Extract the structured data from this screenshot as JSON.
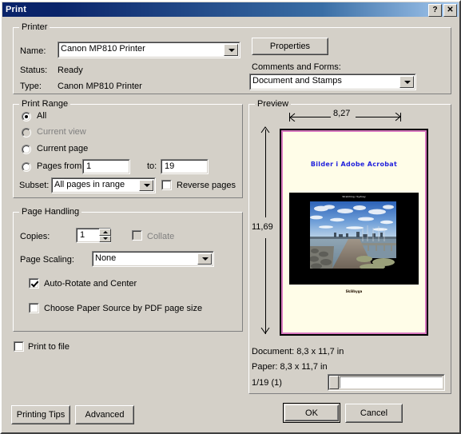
{
  "window": {
    "title": "Print",
    "help_button": "?",
    "close_button": "✕"
  },
  "printer": {
    "group_title": "Printer",
    "name_label": "Name:",
    "name_value": "Canon MP810 Printer",
    "status_label": "Status:",
    "status_value": "Ready",
    "type_label": "Type:",
    "type_value": "Canon MP810 Printer",
    "properties_button": "Properties",
    "comments_label": "Comments and Forms:",
    "comments_value": "Document and Stamps"
  },
  "print_range": {
    "group_title": "Print Range",
    "all_label": "All",
    "current_view_label": "Current view",
    "current_page_label": "Current page",
    "pages_from_label": "Pages from:",
    "pages_from_value": "1",
    "to_label": "to:",
    "to_value": "19",
    "subset_label": "Subset:",
    "subset_value": "All pages in range",
    "reverse_label": "Reverse pages"
  },
  "page_handling": {
    "group_title": "Page Handling",
    "copies_label": "Copies:",
    "copies_value": "1",
    "collate_label": "Collate",
    "scaling_label": "Page Scaling:",
    "scaling_value": "None",
    "auto_rotate_label": "Auto-Rotate and Center",
    "paper_source_label": "Choose Paper Source by PDF page size"
  },
  "print_to_file_label": "Print to file",
  "preview": {
    "group_title": "Preview",
    "width_dimension": "8,27",
    "height_dimension": "11,69",
    "document_info": "Document: 8,3 x 11,7 in",
    "paper_info": "Paper: 8,3 x 11,7 in",
    "page_indicator": "1/19 (1)",
    "page_title": "Bilder i Adobe Acrobat",
    "photo_caption_top": "Stretching i Sydney",
    "page_caption": "Skålbyga"
  },
  "buttons": {
    "printing_tips": "Printing Tips",
    "advanced": "Advanced",
    "ok": "OK",
    "cancel": "Cancel"
  },
  "colors": {
    "titlebar_start": "#0a246a",
    "titlebar_end": "#a6caf0",
    "face": "#d4d0c8",
    "page_paper": "#fffde8",
    "page_border": "#d878c0",
    "title_text_blue": "#2222dd"
  }
}
